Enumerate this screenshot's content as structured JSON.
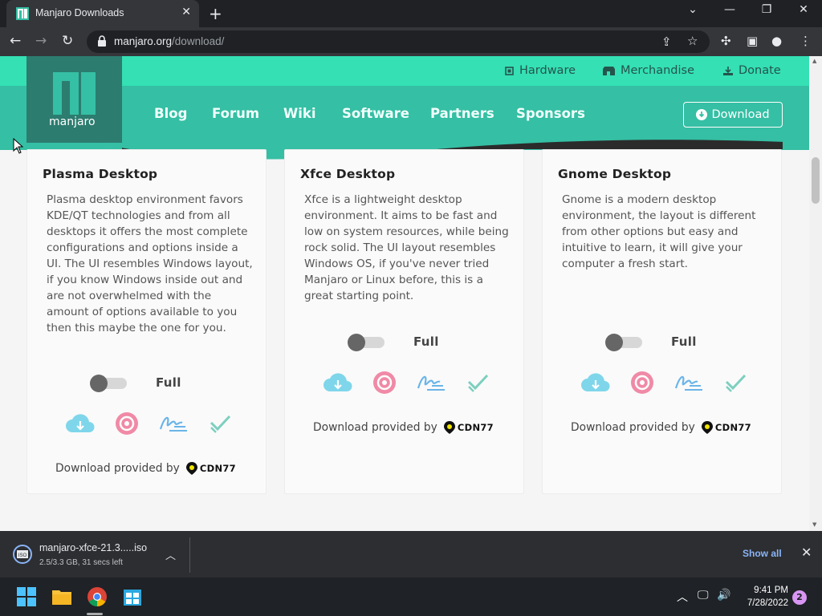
{
  "browser": {
    "tab_title": "Manjaro Downloads",
    "tab_close": "✕",
    "new_tab": "+",
    "window_controls": {
      "minimize": "—",
      "restore": "❐",
      "close": "✕",
      "tabsearch": "⌄"
    },
    "url_domain": "manjaro.org",
    "url_path": "/download/"
  },
  "site": {
    "logo_text": "manjaro",
    "top_links": [
      {
        "label": "Hardware",
        "icon": "chip-icon"
      },
      {
        "label": "Merchandise",
        "icon": "store-icon"
      },
      {
        "label": "Donate",
        "icon": "donate-icon"
      }
    ],
    "nav": [
      "Blog",
      "Forum",
      "Wiki",
      "Software",
      "Partners",
      "Sponsors"
    ],
    "download_button": "Download",
    "colors": {
      "top_strip": "#34e0b4",
      "nav_band": "#35bfa4",
      "logo_bg": "#2c7c6f"
    }
  },
  "editions": [
    {
      "title": "Plasma Desktop",
      "description": "Plasma desktop environment favors KDE/QT technologies and from all desktops it offers the most complete configurations and options inside a UI. The UI resembles Windows layout, if you know Windows inside out and are not overwhelmed with the amount of options available to you then this maybe the one for you.",
      "toggle_label": "Full",
      "provided_by": "Download provided by",
      "cdn": "CDN77"
    },
    {
      "title": "Xfce Desktop",
      "description": "Xfce is a lightweight desktop environment. It aims to be fast and low on system resources, while being rock solid. The UI layout resembles Windows OS, if you've never tried Manjaro or Linux before, this is a great starting point.",
      "toggle_label": "Full",
      "provided_by": "Download provided by",
      "cdn": "CDN77"
    },
    {
      "title": "Gnome Desktop",
      "description": "Gnome is a modern desktop environment, the layout is different from other options but easy and intuitive to learn, it will give your computer a fresh start.",
      "toggle_label": "Full",
      "provided_by": "Download provided by",
      "cdn": "CDN77"
    }
  ],
  "download_bar": {
    "filename": "manjaro-xfce-21.3.....iso",
    "status": "2.5/3.3 GB, 31 secs left",
    "show_all": "Show all"
  },
  "taskbar": {
    "time": "9:41 PM",
    "date": "7/28/2022",
    "notifications": "2"
  }
}
